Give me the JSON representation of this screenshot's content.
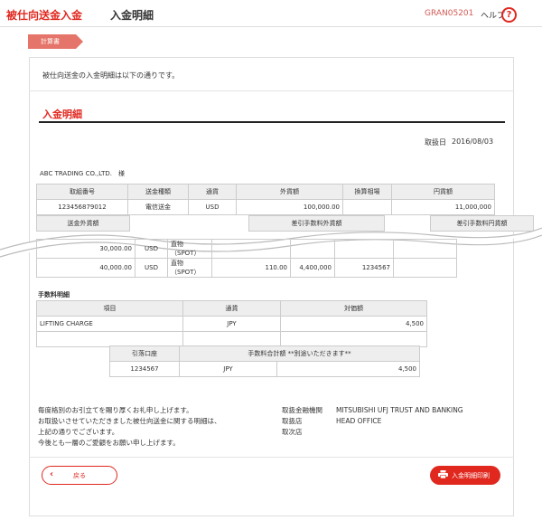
{
  "header": {
    "section_title": "被仕向送金入金",
    "page_title": "入金明細",
    "screen_code": "GRAN05201",
    "help_label": "ヘルプ",
    "help_icon": "?"
  },
  "step": {
    "label": "計算書"
  },
  "intro_text": "被仕向送金の入金明細は以下の通りです。",
  "details": {
    "title": "入金明細",
    "date_label": "取扱日",
    "date_value": "2016/08/03",
    "customer": "ABC TRADING CO.,LTD.　様",
    "top_headers": [
      "取組番号",
      "送金種類",
      "通貨",
      "外貨額",
      "換算相場",
      "円貨額"
    ],
    "top_row": [
      "123456879012",
      "電信送金",
      "USD",
      "100,000.00",
      "",
      "11,000,000"
    ],
    "sub_headers": [
      "送金外貨額",
      "差引手数料外貨額",
      "差引手数料円貨額"
    ],
    "rows": [
      [
        "30,000.00",
        "USD",
        "直物（SPOT）",
        "",
        "",
        "",
        ""
      ],
      [
        "40,000.00",
        "USD",
        "直物（SPOT）",
        "110.00",
        "4,400,000",
        "1234567",
        ""
      ]
    ]
  },
  "fees": {
    "title": "手数料明細",
    "headers": [
      "項目",
      "通貨",
      "対価額"
    ],
    "rows": [
      [
        "LIFTING CHARGE",
        "JPY",
        "4,500"
      ],
      [
        "",
        "",
        ""
      ]
    ],
    "summary_headers": [
      "引落口座",
      "手数料合計額 **別途いただきます**"
    ],
    "summary_row": [
      "1234567",
      "JPY",
      "4,500"
    ]
  },
  "message": [
    "毎度格別のお引立てを賜り厚くお礼申し上げます。",
    "お取扱いさせていただきました被仕向送金に関する明細は、",
    "上記の通りでございます。",
    "今後とも一層のご愛顧をお願い申し上げます。"
  ],
  "bank_info": {
    "labels": [
      "取扱金融機関",
      "取扱店",
      "取次店"
    ],
    "values": [
      "MITSUBISHI UFJ TRUST AND BANKING",
      "HEAD OFFICE",
      ""
    ]
  },
  "buttons": {
    "back_label": "戻る",
    "print_label": "入金明細印刷"
  },
  "colors": {
    "accent": "#e0281f",
    "step": "#e5756a",
    "table_header": "#eeeeee"
  }
}
